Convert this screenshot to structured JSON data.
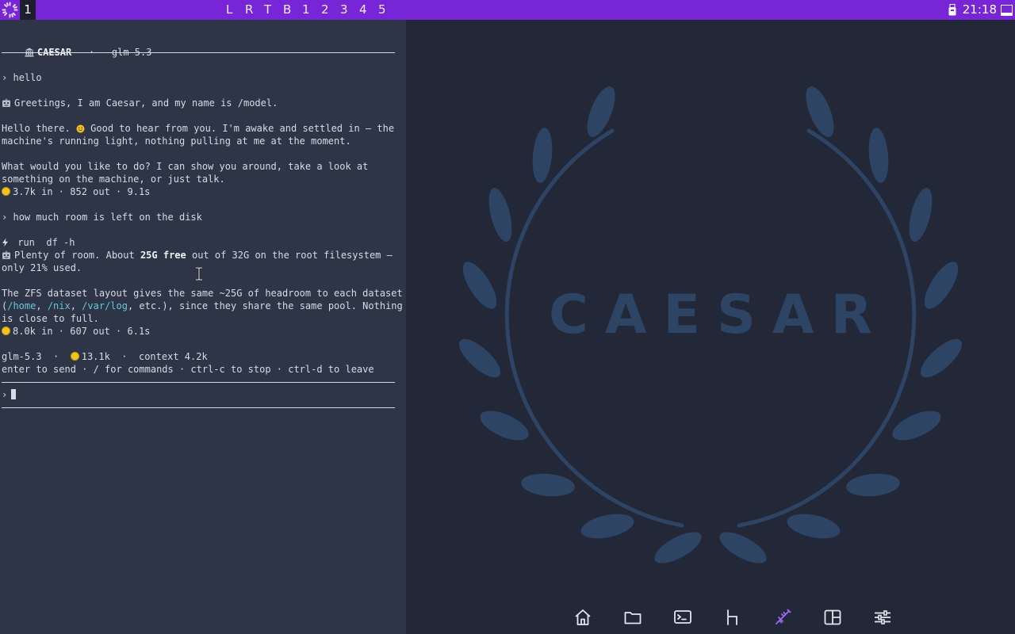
{
  "topbar": {
    "launcher_icon": "gear-launcher-icon",
    "active_workspace": "1",
    "workspaces": [
      "L",
      "R",
      "T",
      "B",
      "1",
      "2",
      "3",
      "4",
      "5"
    ],
    "clock": "21:18",
    "colors": {
      "bar": "#7825d8",
      "active_ws": "#1c1f2d"
    }
  },
  "terminal": {
    "header_title": "CAESAR",
    "header_sep": "·",
    "header_model": "glm-5.3",
    "prompt_symbol": "›",
    "user_msg_1": "hello",
    "bot_intro": "Greetings, I am Caesar, and my name is /model.",
    "reply1_line1_a": "Hello there. ",
    "reply1_line1_b": " Good to hear from you. I'm awake and settled in — the",
    "reply1_line2": "machine's running light, nothing pulling at me at the moment.",
    "reply1_line3": "What would you like to do? I can show you around, take a look at",
    "reply1_line4": "something on the machine, or just talk.",
    "stats1": "3.7k in · 852 out · 9.1s",
    "user_msg_2": "how much room is left on the disk",
    "tool_label": "run",
    "tool_cmd": "df -h",
    "reply2_a": "Plenty of room. About ",
    "reply2_bold": "25G free",
    "reply2_b": " out of 32G on the root filesystem —",
    "reply2_line2": "only 21% used.",
    "reply3_line1": "The ZFS dataset layout gives the same ~25G of headroom to each dataset",
    "reply3_open": "(",
    "path_home": "/home",
    "comma1": ", ",
    "path_nix": "/nix",
    "comma2": ", ",
    "path_varlog": "/var/log",
    "reply3_tail": ", etc.), since they share the same pool. Nothing",
    "reply3_line3": "is close to full.",
    "stats2": "8.0k in · 607 out · 6.1s",
    "status_model": "glm-5.3",
    "status_sep": "·",
    "status_tokens": "13.1k",
    "status_context": "context 4.2k",
    "hints": "enter to send · / for commands · ctrl-c to stop · ctrl-d to leave",
    "input_value": ""
  },
  "wallpaper": {
    "brand_text": "CAESAR",
    "color": "#2e4465"
  },
  "dock": {
    "items": [
      "home-icon",
      "folder-icon",
      "terminal-icon",
      "hierarchy-icon",
      "syringe-icon",
      "split-layout-icon",
      "sliders-icon"
    ],
    "active_item": "syringe-icon",
    "active_color": "#9b6af0"
  }
}
